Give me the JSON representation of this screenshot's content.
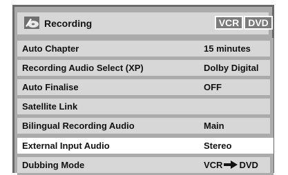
{
  "header": {
    "title": "Recording",
    "icon": "recording-disc-icon",
    "modes": [
      "VCR",
      "DVD"
    ]
  },
  "menu": {
    "items": [
      {
        "label": "Auto Chapter",
        "value": "15 minutes"
      },
      {
        "label": "Recording Audio Select (XP)",
        "value": "Dolby Digital"
      },
      {
        "label": "Auto Finalise",
        "value": "OFF"
      },
      {
        "label": "Satellite Link",
        "value": ""
      },
      {
        "label": "Bilingual Recording Audio",
        "value": "Main"
      },
      {
        "label": "External Input Audio",
        "value": "Stereo"
      },
      {
        "label": "Dubbing Mode",
        "value_from": "VCR",
        "value_to": "DVD"
      }
    ],
    "selected_index": 5
  },
  "colors": {
    "frame": "#ababab",
    "row": "#d7d7d7",
    "selected_row": "#ffffff",
    "badge": "#7b7b7b"
  }
}
